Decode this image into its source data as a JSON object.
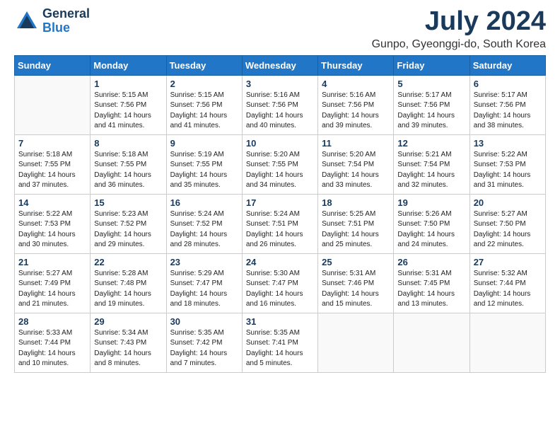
{
  "header": {
    "logo_general": "General",
    "logo_blue": "Blue",
    "month_title": "July 2024",
    "location": "Gunpo, Gyeonggi-do, South Korea"
  },
  "weekdays": [
    "Sunday",
    "Monday",
    "Tuesday",
    "Wednesday",
    "Thursday",
    "Friday",
    "Saturday"
  ],
  "weeks": [
    [
      {
        "day": "",
        "sunrise": "",
        "sunset": "",
        "daylight": ""
      },
      {
        "day": "1",
        "sunrise": "Sunrise: 5:15 AM",
        "sunset": "Sunset: 7:56 PM",
        "daylight": "Daylight: 14 hours and 41 minutes."
      },
      {
        "day": "2",
        "sunrise": "Sunrise: 5:15 AM",
        "sunset": "Sunset: 7:56 PM",
        "daylight": "Daylight: 14 hours and 41 minutes."
      },
      {
        "day": "3",
        "sunrise": "Sunrise: 5:16 AM",
        "sunset": "Sunset: 7:56 PM",
        "daylight": "Daylight: 14 hours and 40 minutes."
      },
      {
        "day": "4",
        "sunrise": "Sunrise: 5:16 AM",
        "sunset": "Sunset: 7:56 PM",
        "daylight": "Daylight: 14 hours and 39 minutes."
      },
      {
        "day": "5",
        "sunrise": "Sunrise: 5:17 AM",
        "sunset": "Sunset: 7:56 PM",
        "daylight": "Daylight: 14 hours and 39 minutes."
      },
      {
        "day": "6",
        "sunrise": "Sunrise: 5:17 AM",
        "sunset": "Sunset: 7:56 PM",
        "daylight": "Daylight: 14 hours and 38 minutes."
      }
    ],
    [
      {
        "day": "7",
        "sunrise": "Sunrise: 5:18 AM",
        "sunset": "Sunset: 7:55 PM",
        "daylight": "Daylight: 14 hours and 37 minutes."
      },
      {
        "day": "8",
        "sunrise": "Sunrise: 5:18 AM",
        "sunset": "Sunset: 7:55 PM",
        "daylight": "Daylight: 14 hours and 36 minutes."
      },
      {
        "day": "9",
        "sunrise": "Sunrise: 5:19 AM",
        "sunset": "Sunset: 7:55 PM",
        "daylight": "Daylight: 14 hours and 35 minutes."
      },
      {
        "day": "10",
        "sunrise": "Sunrise: 5:20 AM",
        "sunset": "Sunset: 7:55 PM",
        "daylight": "Daylight: 14 hours and 34 minutes."
      },
      {
        "day": "11",
        "sunrise": "Sunrise: 5:20 AM",
        "sunset": "Sunset: 7:54 PM",
        "daylight": "Daylight: 14 hours and 33 minutes."
      },
      {
        "day": "12",
        "sunrise": "Sunrise: 5:21 AM",
        "sunset": "Sunset: 7:54 PM",
        "daylight": "Daylight: 14 hours and 32 minutes."
      },
      {
        "day": "13",
        "sunrise": "Sunrise: 5:22 AM",
        "sunset": "Sunset: 7:53 PM",
        "daylight": "Daylight: 14 hours and 31 minutes."
      }
    ],
    [
      {
        "day": "14",
        "sunrise": "Sunrise: 5:22 AM",
        "sunset": "Sunset: 7:53 PM",
        "daylight": "Daylight: 14 hours and 30 minutes."
      },
      {
        "day": "15",
        "sunrise": "Sunrise: 5:23 AM",
        "sunset": "Sunset: 7:52 PM",
        "daylight": "Daylight: 14 hours and 29 minutes."
      },
      {
        "day": "16",
        "sunrise": "Sunrise: 5:24 AM",
        "sunset": "Sunset: 7:52 PM",
        "daylight": "Daylight: 14 hours and 28 minutes."
      },
      {
        "day": "17",
        "sunrise": "Sunrise: 5:24 AM",
        "sunset": "Sunset: 7:51 PM",
        "daylight": "Daylight: 14 hours and 26 minutes."
      },
      {
        "day": "18",
        "sunrise": "Sunrise: 5:25 AM",
        "sunset": "Sunset: 7:51 PM",
        "daylight": "Daylight: 14 hours and 25 minutes."
      },
      {
        "day": "19",
        "sunrise": "Sunrise: 5:26 AM",
        "sunset": "Sunset: 7:50 PM",
        "daylight": "Daylight: 14 hours and 24 minutes."
      },
      {
        "day": "20",
        "sunrise": "Sunrise: 5:27 AM",
        "sunset": "Sunset: 7:50 PM",
        "daylight": "Daylight: 14 hours and 22 minutes."
      }
    ],
    [
      {
        "day": "21",
        "sunrise": "Sunrise: 5:27 AM",
        "sunset": "Sunset: 7:49 PM",
        "daylight": "Daylight: 14 hours and 21 minutes."
      },
      {
        "day": "22",
        "sunrise": "Sunrise: 5:28 AM",
        "sunset": "Sunset: 7:48 PM",
        "daylight": "Daylight: 14 hours and 19 minutes."
      },
      {
        "day": "23",
        "sunrise": "Sunrise: 5:29 AM",
        "sunset": "Sunset: 7:47 PM",
        "daylight": "Daylight: 14 hours and 18 minutes."
      },
      {
        "day": "24",
        "sunrise": "Sunrise: 5:30 AM",
        "sunset": "Sunset: 7:47 PM",
        "daylight": "Daylight: 14 hours and 16 minutes."
      },
      {
        "day": "25",
        "sunrise": "Sunrise: 5:31 AM",
        "sunset": "Sunset: 7:46 PM",
        "daylight": "Daylight: 14 hours and 15 minutes."
      },
      {
        "day": "26",
        "sunrise": "Sunrise: 5:31 AM",
        "sunset": "Sunset: 7:45 PM",
        "daylight": "Daylight: 14 hours and 13 minutes."
      },
      {
        "day": "27",
        "sunrise": "Sunrise: 5:32 AM",
        "sunset": "Sunset: 7:44 PM",
        "daylight": "Daylight: 14 hours and 12 minutes."
      }
    ],
    [
      {
        "day": "28",
        "sunrise": "Sunrise: 5:33 AM",
        "sunset": "Sunset: 7:44 PM",
        "daylight": "Daylight: 14 hours and 10 minutes."
      },
      {
        "day": "29",
        "sunrise": "Sunrise: 5:34 AM",
        "sunset": "Sunset: 7:43 PM",
        "daylight": "Daylight: 14 hours and 8 minutes."
      },
      {
        "day": "30",
        "sunrise": "Sunrise: 5:35 AM",
        "sunset": "Sunset: 7:42 PM",
        "daylight": "Daylight: 14 hours and 7 minutes."
      },
      {
        "day": "31",
        "sunrise": "Sunrise: 5:35 AM",
        "sunset": "Sunset: 7:41 PM",
        "daylight": "Daylight: 14 hours and 5 minutes."
      },
      {
        "day": "",
        "sunrise": "",
        "sunset": "",
        "daylight": ""
      },
      {
        "day": "",
        "sunrise": "",
        "sunset": "",
        "daylight": ""
      },
      {
        "day": "",
        "sunrise": "",
        "sunset": "",
        "daylight": ""
      }
    ]
  ]
}
